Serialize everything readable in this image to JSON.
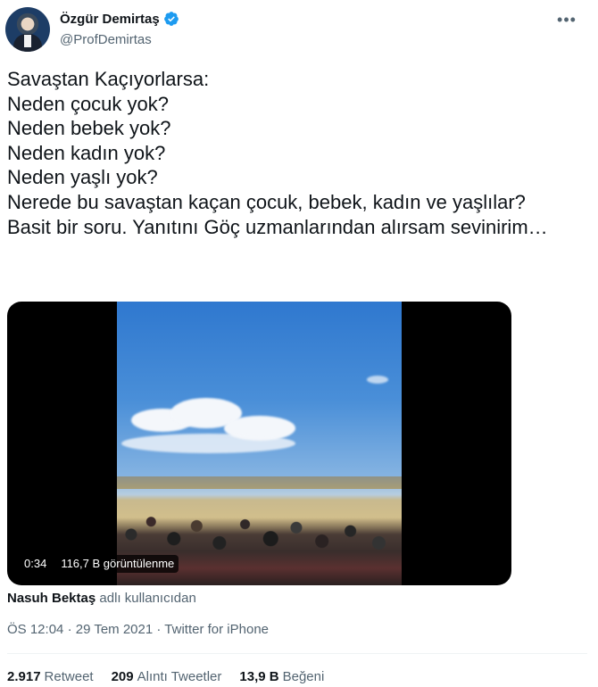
{
  "author": {
    "name": "Özgür Demirtaş",
    "handle": "@ProfDemirtas",
    "verified": true
  },
  "more_icon": "ellipsis-icon",
  "tweet": {
    "text": "Savaştan Kaçıyorlarsa:\nNeden çocuk yok?\nNeden bebek yok?\nNeden kadın yok?\nNeden yaşlı yok?\nNerede bu savaştan kaçan çocuk, bebek, kadın ve yaşlılar?\nBasit bir soru. Yanıtını Göç uzmanlarından alırsam sevinirim…"
  },
  "video": {
    "duration": "0:34",
    "views": "116,7 B görüntülenme"
  },
  "attribution": {
    "user": "Nasuh Bektaş",
    "suffix": "adlı kullanıcıdan"
  },
  "meta": {
    "time": "ÖS 12:04",
    "date": "29 Tem 2021",
    "source": "Twitter for iPhone",
    "sep": "·"
  },
  "stats": {
    "retweets_count": "2.917",
    "retweets_label": "Retweet",
    "quotes_count": "209",
    "quotes_label": "Alıntı Tweetler",
    "likes_count": "13,9 B",
    "likes_label": "Beğeni"
  },
  "colors": {
    "verified": "#1d9bf0",
    "secondary_text": "#536471",
    "primary_text": "#0f1419"
  }
}
